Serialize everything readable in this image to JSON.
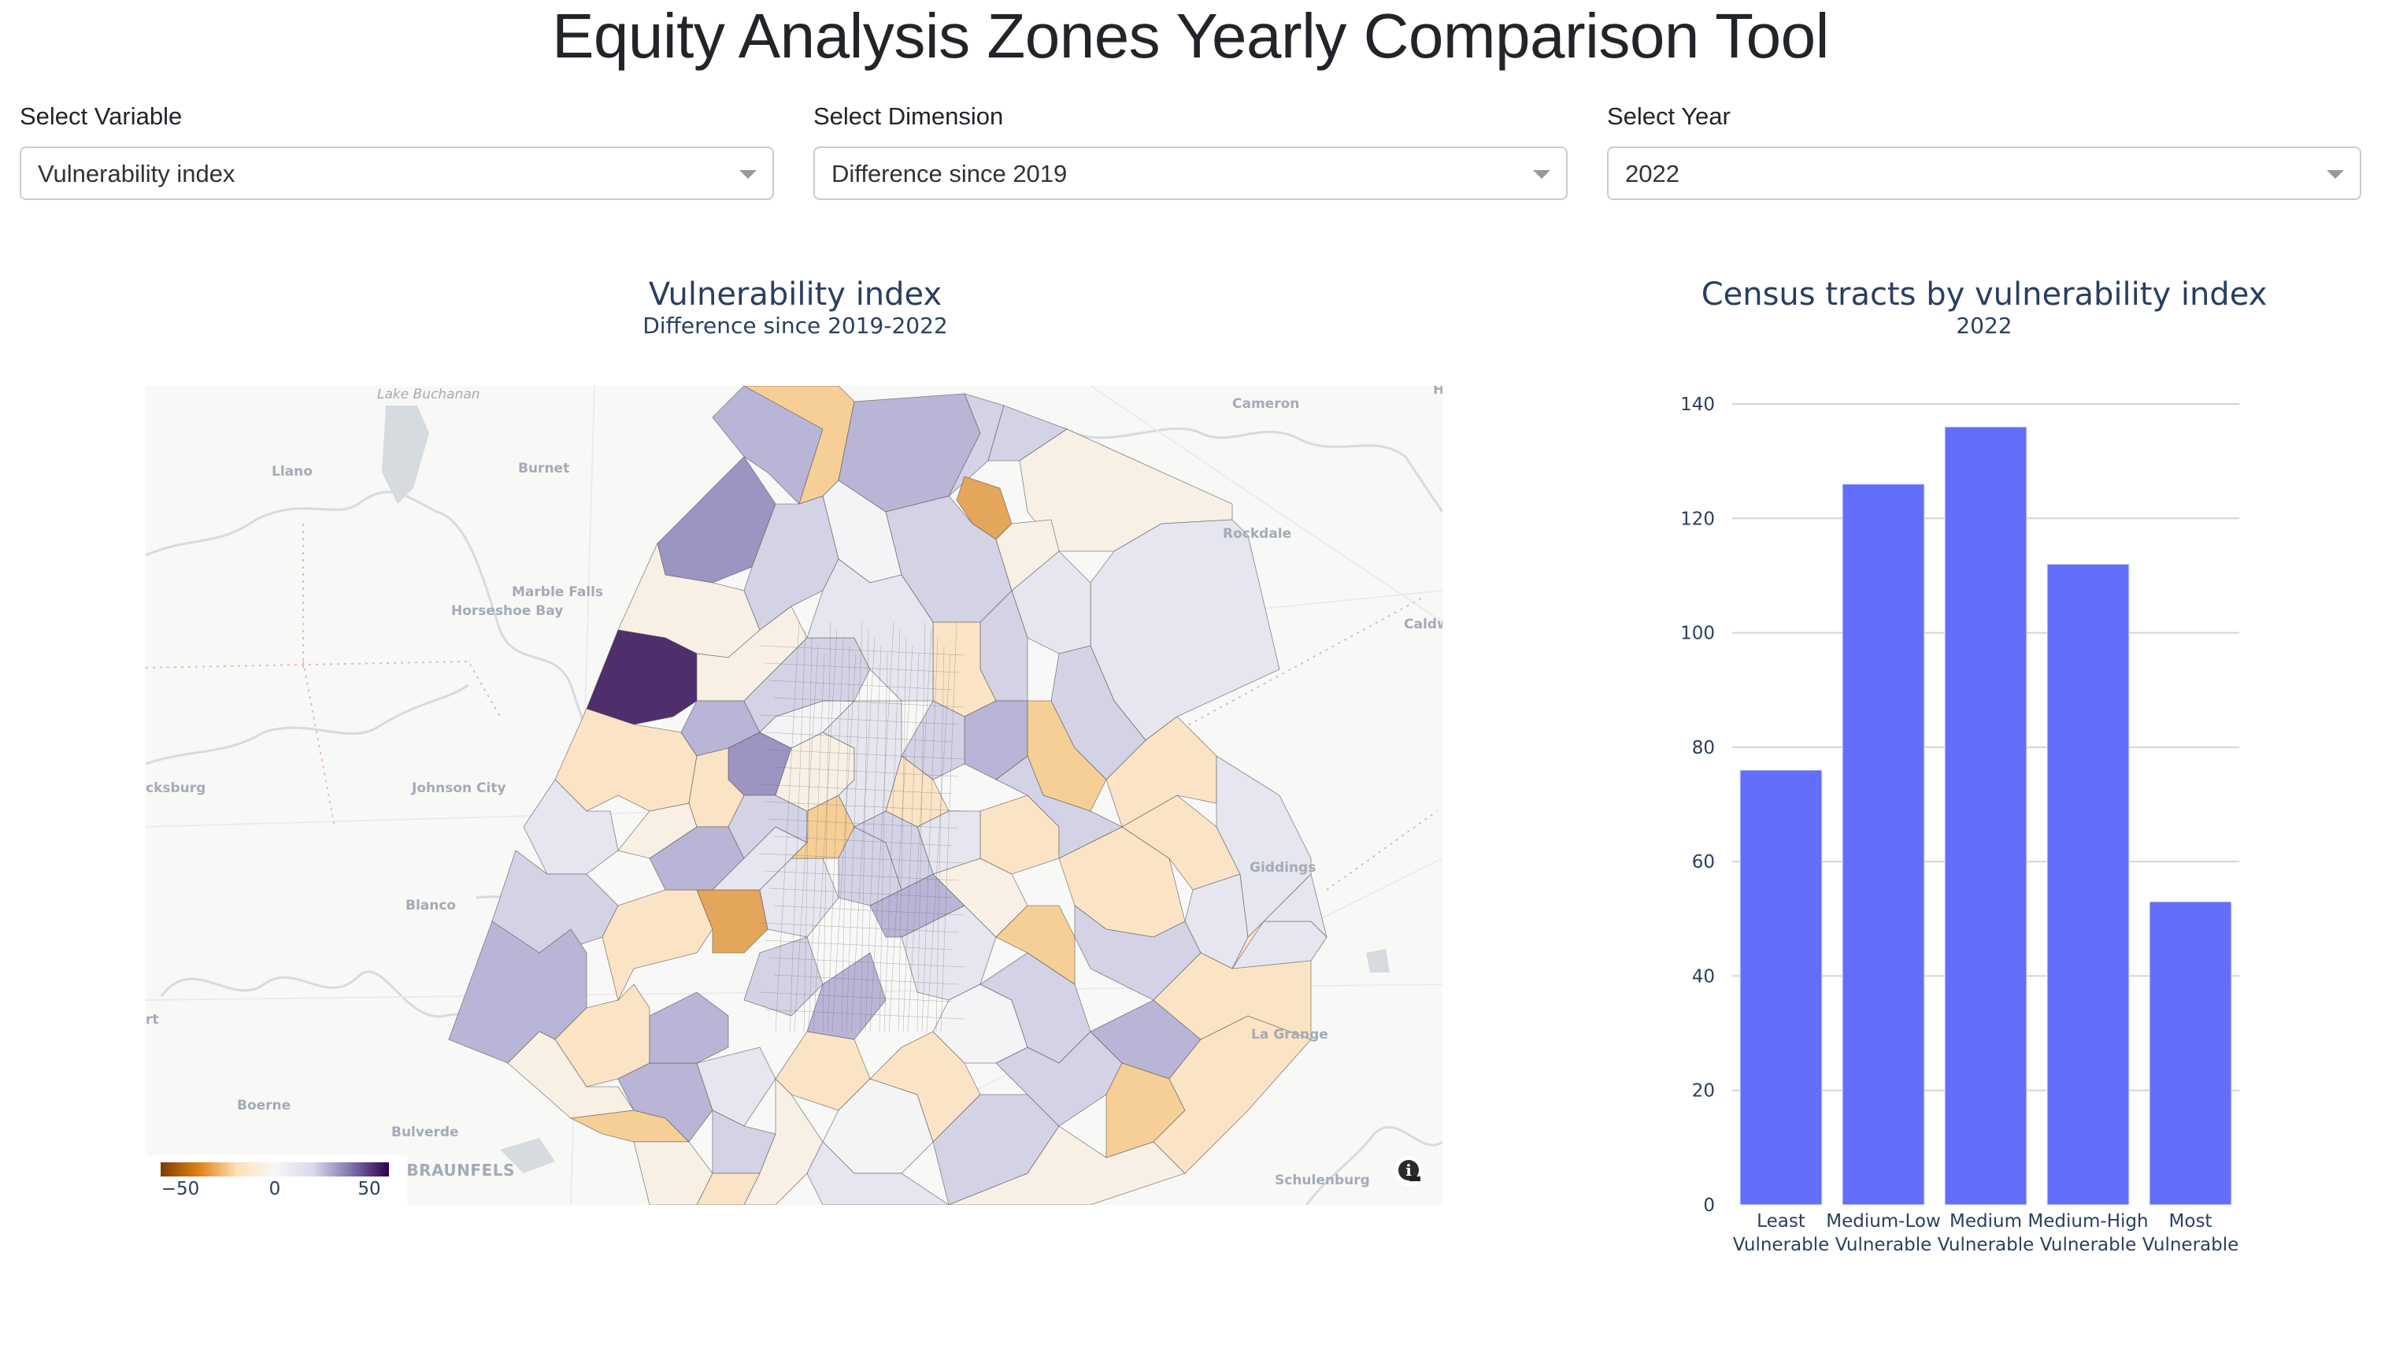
{
  "header": {
    "title": "Equity Analysis Zones Yearly Comparison Tool"
  },
  "controls": [
    {
      "label": "Select Variable",
      "value": "Vulnerability index"
    },
    {
      "label": "Select Dimension",
      "value": "Difference since 2019"
    },
    {
      "label": "Select Year",
      "value": "2022"
    }
  ],
  "map": {
    "title": "Vulnerability index",
    "subtitle": "Difference since 2019-2022",
    "colorscale": {
      "name": "PuOr",
      "colors": [
        "#7f3b08",
        "#e08214",
        "#fee0b6",
        "#f7f7f7",
        "#d8daeb",
        "#8073ac",
        "#2d004b"
      ],
      "ticks": [
        "−50",
        "0",
        "50"
      ],
      "tick_values": [
        -50,
        0,
        50
      ]
    },
    "place_labels": [
      {
        "name": "Lake Buchanan",
        "style": "italic"
      },
      {
        "name": "Llano"
      },
      {
        "name": "Burnet"
      },
      {
        "name": "Marble Falls"
      },
      {
        "name": "Horseshoe Bay"
      },
      {
        "name": "Cameron"
      },
      {
        "name": "Rockdale"
      },
      {
        "name": "Caldwell"
      },
      {
        "name": "He"
      },
      {
        "name": "cksburg"
      },
      {
        "name": "Johnson City"
      },
      {
        "name": "Blanco"
      },
      {
        "name": "rt"
      },
      {
        "name": "Boerne"
      },
      {
        "name": "Bulverde"
      },
      {
        "name": "NEW BRAUNFELS",
        "style": "big"
      },
      {
        "name": "Giddings"
      },
      {
        "name": "La Grange"
      },
      {
        "name": "Schulenburg"
      }
    ],
    "info_icon": "info-icon"
  },
  "bar": {
    "title": "Census tracts by vulnerability index",
    "subtitle": "2022",
    "color": "#636efa"
  },
  "chart_data": {
    "type": "bar",
    "title": "Census tracts by vulnerability index",
    "subtitle": "2022",
    "categories": [
      "Least Vulnerable",
      "Medium-Low Vulnerable",
      "Medium Vulnerable",
      "Medium-High Vulnerable",
      "Most Vulnerable"
    ],
    "category_lines": [
      [
        "Least",
        "Vulnerable"
      ],
      [
        "Medium-Low",
        "Vulnerable"
      ],
      [
        "Medium",
        "Vulnerable"
      ],
      [
        "Medium-High",
        "Vulnerable"
      ],
      [
        "Most",
        "Vulnerable"
      ]
    ],
    "values": [
      76,
      126,
      136,
      112,
      53
    ],
    "xlabel": "",
    "ylabel": "",
    "ylim": [
      0,
      140
    ],
    "yticks": [
      0,
      20,
      40,
      60,
      80,
      100,
      120,
      140
    ],
    "grid": true,
    "legend": "none"
  }
}
